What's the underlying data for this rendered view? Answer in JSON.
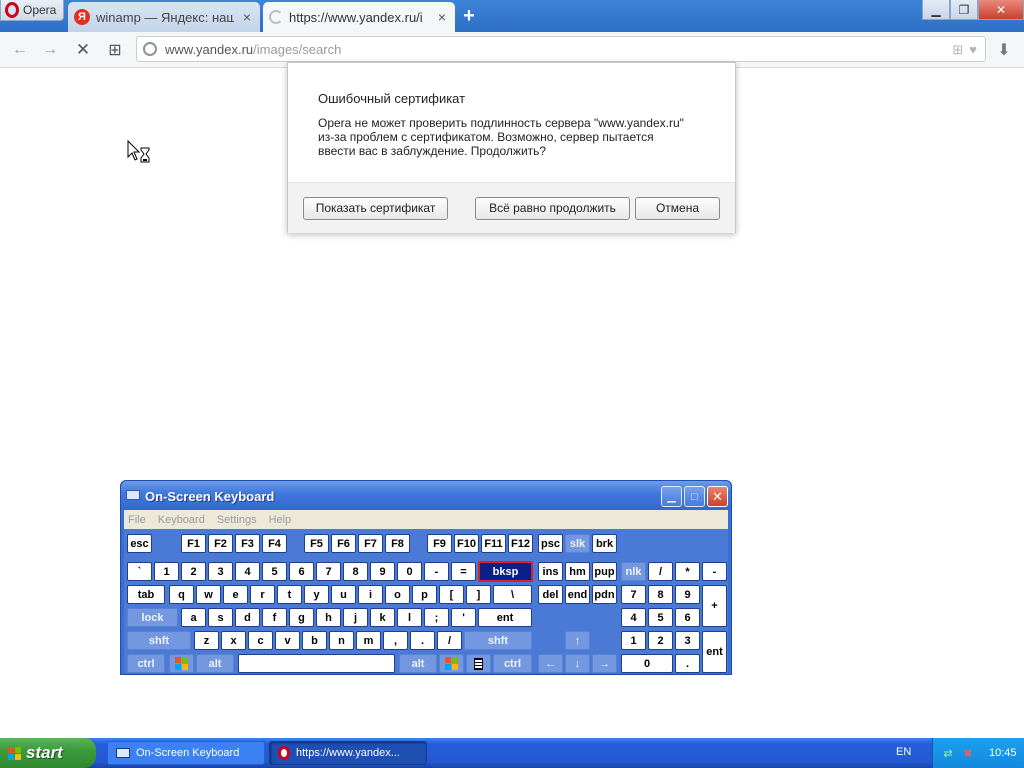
{
  "browser": {
    "menu_label": "Opera",
    "tabs": [
      {
        "title": "winamp — Яндекс: нашл",
        "favicon": "yandex-icon",
        "close": "×"
      },
      {
        "title": "https://www.yandex.ru/i",
        "favicon": "loading-icon",
        "close": "×"
      }
    ],
    "new_tab": "+",
    "window_buttons": {
      "minimize": "▁",
      "restore": "❐",
      "close": "✕"
    },
    "address": {
      "domain": "www.yandex.ru",
      "path": "/images/search"
    },
    "nav_icons": {
      "back": "←",
      "forward": "→",
      "stop": "✕",
      "speed_dial": "⊞",
      "download": "⬇"
    },
    "url_right_icons": {
      "grid": "⊞",
      "heart": "♥"
    }
  },
  "cert_dialog": {
    "title": "Ошибочный сертификат",
    "message": "Opera не может проверить подлинность сервера \"www.yandex.ru\"\nиз-за проблем с сертификатом. Возможно, сервер пытается\nввести вас в заблуждение. Продолжить?",
    "buttons": {
      "show_cert": "Показать сертификат",
      "continue": "Всё равно продолжить",
      "cancel": "Отмена"
    }
  },
  "osk": {
    "title": "On-Screen Keyboard",
    "menu": [
      "File",
      "Keyboard",
      "Settings",
      "Help"
    ],
    "title_buttons": {
      "minimize": "▁",
      "maximize": "□",
      "close": "✕"
    },
    "keys": {
      "esc": "esc",
      "f1": "F1",
      "f2": "F2",
      "f3": "F3",
      "f4": "F4",
      "f5": "F5",
      "f6": "F6",
      "f7": "F7",
      "f8": "F8",
      "f9": "F9",
      "f10": "F10",
      "f11": "F11",
      "f12": "F12",
      "psc": "psc",
      "slk": "slk",
      "brk": "brk",
      "grave": "`",
      "k1": "1",
      "k2": "2",
      "k3": "3",
      "k4": "4",
      "k5": "5",
      "k6": "6",
      "k7": "7",
      "k8": "8",
      "k9": "9",
      "k0": "0",
      "minus": "-",
      "equals": "=",
      "bksp": "bksp",
      "ins": "ins",
      "hm": "hm",
      "pup": "pup",
      "nlk": "nlk",
      "np_div": "/",
      "np_mul": "*",
      "np_sub": "-",
      "tab": "tab",
      "q": "q",
      "w": "w",
      "e": "e",
      "r": "r",
      "t": "t",
      "y": "y",
      "u": "u",
      "i": "i",
      "o": "o",
      "p": "p",
      "lbracket": "[",
      "rbracket": "]",
      "backslash": "\\",
      "del": "del",
      "end": "end",
      "pdn": "pdn",
      "np7": "7",
      "np8": "8",
      "np9": "9",
      "np_add": "+",
      "lock": "lock",
      "a": "a",
      "s": "s",
      "d": "d",
      "f": "f",
      "g": "g",
      "h": "h",
      "j": "j",
      "k": "k",
      "l": "l",
      "semicolon": ";",
      "quote": "'",
      "ent": "ent",
      "np4": "4",
      "np5": "5",
      "np6": "6",
      "lshift": "shft",
      "z": "z",
      "x": "x",
      "c": "c",
      "v": "v",
      "b": "b",
      "n": "n",
      "m": "m",
      "comma": ",",
      "period": ".",
      "slash": "/",
      "rshift": "shft",
      "up": "↑",
      "np1": "1",
      "np2": "2",
      "np3": "3",
      "np_ent": "ent",
      "lctrl": "ctrl",
      "lalt": "alt",
      "space": "",
      "ralt": "alt",
      "rctrl": "ctrl",
      "left": "←",
      "down": "↓",
      "right": "→",
      "np0": "0",
      "np_dot": "."
    }
  },
  "taskbar": {
    "start": "start",
    "tasks": [
      {
        "label": "On-Screen Keyboard",
        "icon": "keyboard-icon"
      },
      {
        "label": "https://www.yandex...",
        "icon": "opera-icon"
      }
    ],
    "language": "EN",
    "time": "10:45"
  },
  "colors": {
    "tab_strip": "#2d6fc4",
    "dialog_footer": "#f2f2f2",
    "osk_body": "#4a7ad6",
    "osk_highlight": "#0a1f8a",
    "taskbar": "#245edb",
    "start_green": "#3c9b3c"
  }
}
